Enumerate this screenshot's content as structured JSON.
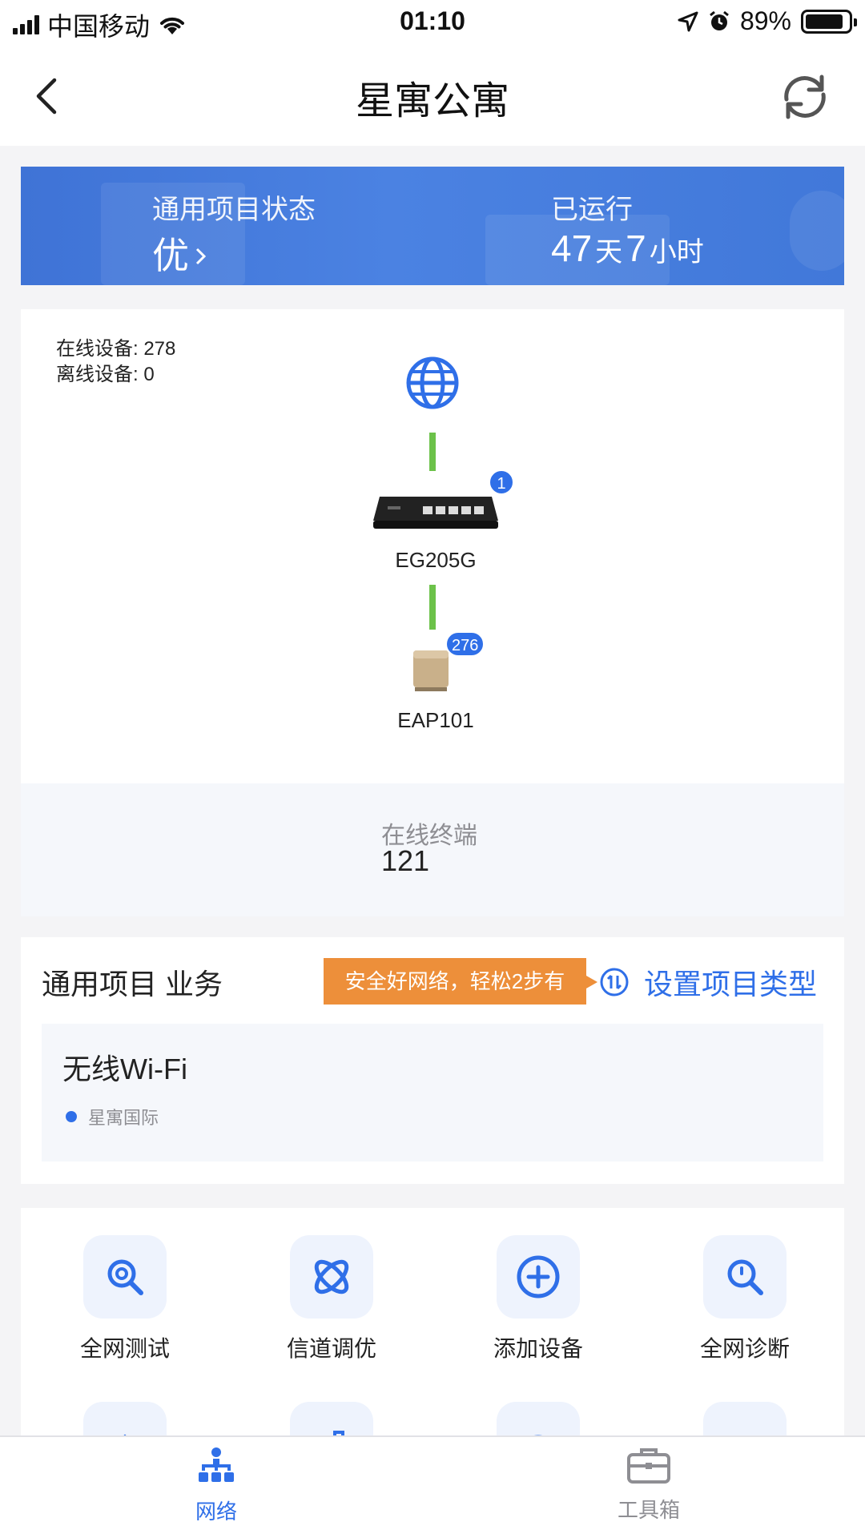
{
  "status_bar": {
    "carrier": "中国移动",
    "time": "01:10",
    "battery": "89%"
  },
  "header": {
    "title": "星寓公寓"
  },
  "banner": {
    "status_label": "通用项目状态",
    "status_value": "优",
    "runtime_label": "已运行",
    "runtime_days": "47",
    "days_unit": "天",
    "runtime_hours": "7",
    "hours_unit": "小时"
  },
  "topology": {
    "online_devices": "在线设备: 278",
    "offline_devices": "离线设备: 0",
    "gateway": {
      "name": "EG205G",
      "badge": "1"
    },
    "ap": {
      "name": "EAP101",
      "badge": "276"
    }
  },
  "terminals": {
    "label": "在线终端",
    "value": "121"
  },
  "business": {
    "title": "通用项目 业务",
    "tip": "安全好网络，轻松2步有",
    "set_type": "设置项目类型",
    "wifi_title": "无线Wi-Fi",
    "wifi_sub": "星寓国际"
  },
  "tools": [
    {
      "label": "全网测试",
      "icon": "search-target-icon"
    },
    {
      "label": "信道调优",
      "icon": "orbit-icon"
    },
    {
      "label": "添加设备",
      "icon": "plus-circle-icon"
    },
    {
      "label": "全网诊断",
      "icon": "search-icon"
    }
  ],
  "tabbar": {
    "network": "网络",
    "toolbox": "工具箱"
  },
  "colors": {
    "accent": "#2f6fe8",
    "banner": "#4178d9",
    "tip": "#ed8f3a",
    "link": "#6cc24a"
  }
}
